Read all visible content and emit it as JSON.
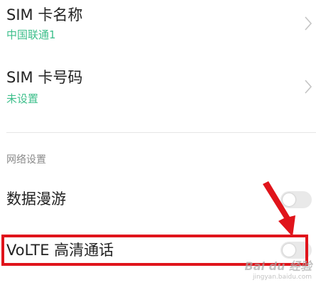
{
  "sim_settings": {
    "sim_name": {
      "title": "SIM 卡名称",
      "value": "中国联通1"
    },
    "sim_number": {
      "title": "SIM 卡号码",
      "value": "未设置"
    }
  },
  "network_settings": {
    "header": "网络设置",
    "data_roaming": {
      "label": "数据漫游",
      "enabled": false
    },
    "volte": {
      "label": "VoLTE 高清通话",
      "enabled": false
    }
  },
  "colors": {
    "subtitle": "#3dbf8b",
    "highlight": "#e0141b",
    "toggle_off": "#e9e9e9"
  },
  "watermark": {
    "text": "Bai du 经验",
    "sub": "jingyan.baidu.com"
  }
}
